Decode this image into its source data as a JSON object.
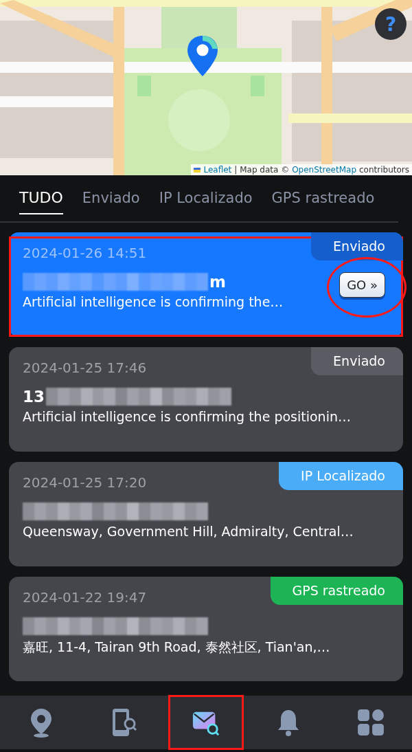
{
  "map": {
    "help": "?",
    "attribution": {
      "library": "Leaflet",
      "text": "| Map data ©",
      "source": "OpenStreetMap",
      "suffix": "contributors"
    }
  },
  "tabs": [
    {
      "label": "TUDO",
      "selected": true
    },
    {
      "label": "Enviado",
      "selected": false
    },
    {
      "label": "IP Localizado",
      "selected": false
    },
    {
      "label": "GPS rastreado",
      "selected": false
    }
  ],
  "cards": [
    {
      "date": "2024-01-26 14:51",
      "status": "Enviado",
      "color": "#155fcc",
      "selected": true,
      "highlighted": true,
      "title_suffix": "m",
      "description": "Artificial intelligence is confirming the…",
      "button": {
        "label": "GO »",
        "circled": true
      }
    },
    {
      "date": "2024-01-25 17:46",
      "status": "Enviado",
      "color": "#5b5c63",
      "selected": false,
      "highlighted": false,
      "title_prefix": "13",
      "description": "Artificial intelligence is confirming the positionin…"
    },
    {
      "date": "2024-01-25 17:20",
      "status": "IP Localizado",
      "color": "#4aacf7",
      "selected": false,
      "highlighted": false,
      "description": "Queensway, Government Hill, Admiralty, Central…"
    },
    {
      "date": "2024-01-22 19:47",
      "status": "GPS rastreado",
      "color": "#1db455",
      "selected": false,
      "highlighted": false,
      "description": "嘉旺, 11-4, Tairan 9th Road, 泰然社区, Tian'an,…"
    }
  ],
  "nav": [
    {
      "kind": "location",
      "selected": false,
      "highlighted": false
    },
    {
      "kind": "phone-search",
      "selected": false,
      "highlighted": false
    },
    {
      "kind": "mail-search",
      "selected": true,
      "highlighted": true
    },
    {
      "kind": "bell",
      "selected": false,
      "highlighted": false
    },
    {
      "kind": "apps",
      "selected": false,
      "highlighted": false
    }
  ]
}
